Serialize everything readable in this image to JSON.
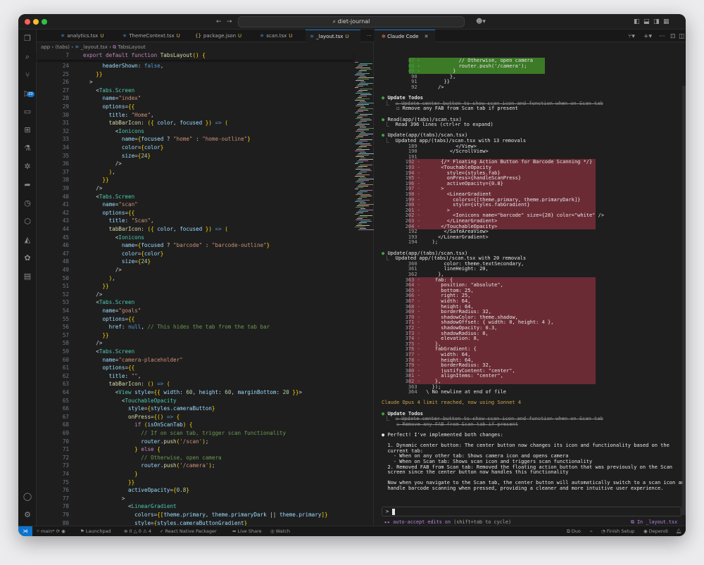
{
  "window": {
    "title": "diet-journal"
  },
  "editor_tabs": [
    {
      "label": "analytics.tsx",
      "status": "U",
      "icon": "react-icon"
    },
    {
      "label": "ThemeContext.tsx",
      "status": "U",
      "icon": "react-icon"
    },
    {
      "label": "package.json",
      "status": "U",
      "icon": "json-icon"
    },
    {
      "label": "scan.tsx",
      "status": "U",
      "icon": "react-icon"
    },
    {
      "label": "_layout.tsx",
      "status": "U",
      "icon": "react-icon"
    }
  ],
  "breadcrumb": [
    "app",
    "(tabs)",
    "_layout.tsx",
    "TabsLayout"
  ],
  "scm_badge": "20",
  "code_lines": [
    [
      "7",
      "<span class=\"kw\">export default function</span> <span class=\"fn\">TabsLayout</span><span class=\"br\">()</span> <span class=\"br\">{</span>"
    ],
    [
      "24",
      "      <span class=\"at\">headerShown</span>: <span class=\"vb\">false</span>,"
    ],
    [
      "25",
      "    <span class=\"br\">}}</span>"
    ],
    [
      "26",
      "  >"
    ],
    [
      "27",
      "    &lt;<span class=\"tg\">Tabs.Screen</span>"
    ],
    [
      "28",
      "      <span class=\"at\">name</span>=<span class=\"st\">\"index\"</span>"
    ],
    [
      "29",
      "      <span class=\"at\">options</span>=<span class=\"br\">{{</span>"
    ],
    [
      "30",
      "        <span class=\"at\">title</span>: <span class=\"st\">\"Home\"</span>,"
    ],
    [
      "31",
      "        <span class=\"fn\">tabBarIcon</span>: <span class=\"br\">({</span> <span class=\"at\">color</span>, <span class=\"at\">focused</span> <span class=\"br\">})</span> <span class=\"vb\">=&gt;</span> <span class=\"br\">(</span>"
    ],
    [
      "32",
      "          &lt;<span class=\"tg\">Ionicons</span>"
    ],
    [
      "33",
      "            <span class=\"at\">name</span>=<span class=\"br\">{</span><span class=\"at\">focused</span> ? <span class=\"st\">\"home\"</span> : <span class=\"st\">\"home-outline\"</span><span class=\"br\">}</span>"
    ],
    [
      "34",
      "            <span class=\"at\">color</span>=<span class=\"br\">{</span><span class=\"at\">color</span><span class=\"br\">}</span>"
    ],
    [
      "35",
      "            <span class=\"at\">size</span>=<span class=\"br\">{</span><span class=\"nu\">24</span><span class=\"br\">}</span>"
    ],
    [
      "36",
      "          /&gt;"
    ],
    [
      "37",
      "        <span class=\"br\">)</span>,"
    ],
    [
      "38",
      "      <span class=\"br\">}}</span>"
    ],
    [
      "39",
      "    /&gt;"
    ],
    [
      "40",
      "    &lt;<span class=\"tg\">Tabs.Screen</span>"
    ],
    [
      "41",
      "      <span class=\"at\">name</span>=<span class=\"st\">\"scan\"</span>"
    ],
    [
      "42",
      "      <span class=\"at\">options</span>=<span class=\"br\">{{</span>"
    ],
    [
      "43",
      "        <span class=\"at\">title</span>: <span class=\"st\">\"Scan\"</span>,"
    ],
    [
      "44",
      "        <span class=\"fn\">tabBarIcon</span>: <span class=\"br\">({</span> <span class=\"at\">color</span>, <span class=\"at\">focused</span> <span class=\"br\">})</span> <span class=\"vb\">=&gt;</span> <span class=\"br\">(</span>"
    ],
    [
      "45",
      "          &lt;<span class=\"tg\">Ionicons</span>"
    ],
    [
      "46",
      "            <span class=\"at\">name</span>=<span class=\"br\">{</span><span class=\"at\">focused</span> ? <span class=\"st\">\"barcode\"</span> : <span class=\"st\">\"barcode-outline\"</span><span class=\"br\">}</span>"
    ],
    [
      "47",
      "            <span class=\"at\">color</span>=<span class=\"br\">{</span><span class=\"at\">color</span><span class=\"br\">}</span>"
    ],
    [
      "48",
      "            <span class=\"at\">size</span>=<span class=\"br\">{</span><span class=\"nu\">24</span><span class=\"br\">}</span>"
    ],
    [
      "49",
      "          /&gt;"
    ],
    [
      "50",
      "        <span class=\"br\">)</span>,"
    ],
    [
      "51",
      "      <span class=\"br\">}}</span>"
    ],
    [
      "52",
      "    /&gt;"
    ],
    [
      "53",
      "    &lt;<span class=\"tg\">Tabs.Screen</span>"
    ],
    [
      "54",
      "      <span class=\"at\">name</span>=<span class=\"st\">\"goals\"</span>"
    ],
    [
      "55",
      "      <span class=\"at\">options</span>=<span class=\"br\">{{</span>"
    ],
    [
      "56",
      "        <span class=\"at\">href</span>: <span class=\"vb\">null</span>, <span class=\"cm\">// This hides the tab from the tab bar</span>"
    ],
    [
      "57",
      "      <span class=\"br\">}}</span>"
    ],
    [
      "58",
      "    /&gt;"
    ],
    [
      "59",
      "    &lt;<span class=\"tg\">Tabs.Screen</span>"
    ],
    [
      "60",
      "      <span class=\"at\">name</span>=<span class=\"st\">\"camera-placeholder\"</span>"
    ],
    [
      "61",
      "      <span class=\"at\">options</span>=<span class=\"br\">{{</span>"
    ],
    [
      "62",
      "        <span class=\"at\">title</span>: <span class=\"st\">\"\"</span>,"
    ],
    [
      "63",
      "        <span class=\"fn\">tabBarIcon</span>: <span class=\"br\">()</span> <span class=\"vb\">=&gt;</span> <span class=\"br\">(</span>"
    ],
    [
      "64",
      "          &lt;<span class=\"tg\">View</span> <span class=\"at\">style</span>=<span class=\"br\">{{</span> <span class=\"at\">width</span>: <span class=\"nu\">60</span>, <span class=\"at\">height</span>: <span class=\"nu\">60</span>, <span class=\"at\">marginBottom</span>: <span class=\"nu\">20</span> <span class=\"br\">}}</span>&gt;"
    ],
    [
      "65",
      "            &lt;<span class=\"tg\">TouchableOpacity</span>"
    ],
    [
      "66",
      "              <span class=\"at\">style</span>=<span class=\"br\">{</span><span class=\"at\">styles.cameraButton</span><span class=\"br\">}</span>"
    ],
    [
      "67",
      "              <span class=\"fn\">onPress</span>=<span class=\"br\">{()</span> <span class=\"vb\">=&gt;</span> <span class=\"br\">{</span>"
    ],
    [
      "68",
      "                <span class=\"kw\">if</span> <span class=\"br\">(</span><span class=\"at\">isOnScanTab</span><span class=\"br\">)</span> <span class=\"br\">{</span>"
    ],
    [
      "69",
      "                  <span class=\"cm\">// If on scan tab, trigger scan functionality</span>"
    ],
    [
      "70",
      "                  <span class=\"at\">router</span>.<span class=\"fn\">push</span><span class=\"br\">(</span><span class=\"st\">'/scan'</span><span class=\"br\">)</span>;"
    ],
    [
      "71",
      "                <span class=\"br\">}</span> <span class=\"kw\">else</span> <span class=\"br\">{</span>"
    ],
    [
      "72",
      "                  <span class=\"cm\">// Otherwise, open camera</span>"
    ],
    [
      "73",
      "                  <span class=\"at\">router</span>.<span class=\"fn\">push</span><span class=\"br\">(</span><span class=\"st\">'/camera'</span><span class=\"br\">)</span>;"
    ],
    [
      "74",
      "                <span class=\"br\">}</span>"
    ],
    [
      "75",
      "              <span class=\"br\">}}</span>"
    ],
    [
      "76",
      "              <span class=\"at\">activeOpacity</span>=<span class=\"br\">{</span><span class=\"nu\">0.8</span><span class=\"br\">}</span>"
    ],
    [
      "77",
      "            >"
    ],
    [
      "78",
      "              &lt;<span class=\"tg\">LinearGradient</span>"
    ],
    [
      "79",
      "                <span class=\"at\">colors</span>=<span class=\"br\">{[</span><span class=\"at\">theme.primary</span>, <span class=\"at\">theme.primaryDark</span> || <span class=\"at\">theme.primary</span><span class=\"br\">]}</span>"
    ],
    [
      "80",
      "                <span class=\"at\">style</span>=<span class=\"br\">{</span><span class=\"at\">styles.cameraButtonGradient</span><span class=\"br\">}</span>"
    ]
  ],
  "panel": {
    "tab_label": "Claude Code",
    "rows": [
      [
        "87 +",
        "          // Otherwise, open camera",
        "w",
        "add"
      ],
      [
        "88 +",
        "          router.push('/camera');",
        "w",
        "add"
      ],
      [
        "89 +",
        "        }",
        "w",
        "add"
      ],
      [
        "90",
        "        },",
        "w",
        ""
      ],
      [
        "91",
        "      }}",
        "w",
        ""
      ],
      [
        "92",
        "    />",
        "w",
        ""
      ],
      [
        "",
        "",
        "",
        ""
      ],
      [
        "●",
        "Update Todos",
        "b",
        "g"
      ],
      [
        "  ⎿",
        "☒ Update center button to show scan icon and function when on Scan tab",
        "s",
        ""
      ],
      [
        "",
        "☐ Remove any FAB from Scan tab if present",
        "w",
        "ind"
      ],
      [
        "",
        "",
        "",
        ""
      ],
      [
        "●",
        "Read(app/(tabs)/scan.tsx)",
        "w",
        "g"
      ],
      [
        "  ⎿",
        "Read 396 lines (ctrl+r to expand)",
        "w",
        ""
      ],
      [
        "",
        "",
        "",
        ""
      ],
      [
        "●",
        "Update(app/(tabs)/scan.tsx)",
        "w",
        "g"
      ],
      [
        "  ⎿",
        "Updated app/(tabs)/scan.tsx with 13 removals",
        "w",
        ""
      ],
      [
        "189",
        "          </View>",
        "w",
        ""
      ],
      [
        "190",
        "        </ScrollView>",
        "w",
        ""
      ],
      [
        "191",
        "",
        "w",
        ""
      ],
      [
        "192 -",
        "      {/* Floating Action Button for Barcode Scanning */}",
        "w",
        "del"
      ],
      [
        "193 -",
        "      <TouchableOpacity",
        "w",
        "del"
      ],
      [
        "194 -",
        "        style={styles.fab}",
        "w",
        "del"
      ],
      [
        "195 -",
        "        onPress={handleScanPress}",
        "w",
        "del"
      ],
      [
        "196 -",
        "        activeOpacity={0.8}",
        "w",
        "del"
      ],
      [
        "197 -",
        "      >",
        "w",
        "del"
      ],
      [
        "198 -",
        "        <LinearGradient",
        "w",
        "del"
      ],
      [
        "199 -",
        "          colors={[theme.primary, theme.primaryDark]}",
        "w",
        "del"
      ],
      [
        "200 -",
        "          style={styles.fabGradient}",
        "w",
        "del"
      ],
      [
        "201 -",
        "        >",
        "w",
        "del"
      ],
      [
        "202 -",
        "          <Ionicons name=\"barcode\" size={28} color=\"white\" />",
        "w",
        "del"
      ],
      [
        "203 -",
        "        </LinearGradient>",
        "w",
        "del"
      ],
      [
        "204 -",
        "      </TouchableOpacity>",
        "w",
        "del"
      ],
      [
        "192",
        "      </SafeAreaView>",
        "w",
        ""
      ],
      [
        "193",
        "    </LinearGradient>",
        "w",
        ""
      ],
      [
        "194",
        "  );",
        "w",
        ""
      ],
      [
        "",
        "",
        "",
        ""
      ],
      [
        "●",
        "Update(app/(tabs)/scan.tsx)",
        "w",
        "g"
      ],
      [
        "  ⎿",
        "Updated app/(tabs)/scan.tsx with 20 removals",
        "w",
        ""
      ],
      [
        "360",
        "      color: theme.textSecondary,",
        "w",
        ""
      ],
      [
        "361",
        "      lineHeight: 20,",
        "w",
        ""
      ],
      [
        "362",
        "    },",
        "w",
        ""
      ],
      [
        "363 -",
        "    fab: {",
        "w",
        "del"
      ],
      [
        "364 -",
        "      position: \"absolute\",",
        "w",
        "del"
      ],
      [
        "365 -",
        "      bottom: 25,",
        "w",
        "del"
      ],
      [
        "366 -",
        "      right: 25,",
        "w",
        "del"
      ],
      [
        "367 -",
        "      width: 64,",
        "w",
        "del"
      ],
      [
        "368 -",
        "      height: 64,",
        "w",
        "del"
      ],
      [
        "369 -",
        "      borderRadius: 32,",
        "w",
        "del"
      ],
      [
        "370 -",
        "      shadowColor: theme.shadow,",
        "w",
        "del"
      ],
      [
        "371 -",
        "      shadowOffset: { width: 0, height: 4 },",
        "w",
        "del"
      ],
      [
        "372 -",
        "      shadowOpacity: 0.3,",
        "w",
        "del"
      ],
      [
        "373 -",
        "      shadowRadius: 8,",
        "w",
        "del"
      ],
      [
        "374 -",
        "      elevation: 8,",
        "w",
        "del"
      ],
      [
        "375 -",
        "    },",
        "w",
        "del"
      ],
      [
        "376 -",
        "    fabGradient: {",
        "w",
        "del"
      ],
      [
        "377 -",
        "      width: 64,",
        "w",
        "del"
      ],
      [
        "378 -",
        "      height: 64,",
        "w",
        "del"
      ],
      [
        "379 -",
        "      borderRadius: 32,",
        "w",
        "del"
      ],
      [
        "380 -",
        "      justifyContent: \"center\",",
        "w",
        "del"
      ],
      [
        "381 -",
        "      alignItems: \"center\",",
        "w",
        "del"
      ],
      [
        "382 -",
        "    },",
        "w",
        "del"
      ],
      [
        "363",
        "  });",
        "w",
        ""
      ],
      [
        "364",
        "\\ No newline at end of file",
        "w",
        ""
      ],
      [
        "",
        "",
        "",
        ""
      ],
      [
        "",
        "Claude Opus 4 limit reached, now using Sonnet 4",
        "y",
        "flush"
      ],
      [
        "",
        "",
        "",
        ""
      ],
      [
        "●",
        "Update Todos",
        "b",
        "g"
      ],
      [
        "  ⎿",
        "☒ Update center button to show scan icon and function when on Scan tab",
        "s",
        ""
      ],
      [
        "",
        "☒ Remove any FAB from Scan tab if present",
        "s",
        "ind"
      ],
      [
        "",
        "",
        "",
        ""
      ],
      [
        "●",
        "Perfect! I've implemented both changes:",
        "w",
        "w"
      ],
      [
        "",
        "",
        "",
        ""
      ],
      [
        "",
        "1. Dynamic center button: The center button now changes its icon and functionality based on the",
        "w",
        "para"
      ],
      [
        "",
        "current tab:",
        "w",
        "para"
      ],
      [
        "",
        "  - When on any other tab: Shows camera icon and opens camera",
        "w",
        "para"
      ],
      [
        "",
        "  - When on Scan tab: Shows scan icon and triggers scan functionality",
        "w",
        "para"
      ],
      [
        "",
        "2. Removed FAB from Scan tab: Removed the floating action button that was previously on the Scan",
        "w",
        "para"
      ],
      [
        "",
        "screen since the center button now handles this functionality",
        "w",
        "para"
      ],
      [
        "",
        "",
        "",
        ""
      ],
      [
        "",
        "Now when you navigate to the Scan tab, the center button will automatically switch to a scan icon and",
        "w",
        "para"
      ],
      [
        "",
        "handle barcode scanning when pressed, providing a cleaner and more intuitive user experience.",
        "w",
        "para"
      ]
    ],
    "prompt": ">",
    "hint_left": "▸▸ auto-accept edits on",
    "hint_mid": "(shift+tab to cycle)",
    "hint_right": "In _layout.tsx"
  },
  "status_bar": {
    "branch": "main*",
    "launchpad": "Launchpad",
    "problems": "⊗ 0 △ 0 ⚠ 4",
    "packager": "React Native Packager",
    "live_share": "Live Share",
    "watch": "Watch",
    "duo": "Duo",
    "finish_setup": "Finish Setup",
    "dependi": "Dependi"
  },
  "colors": {
    "accent": "#0e73cc",
    "add": "#3c7a27",
    "del": "#6b2b35"
  }
}
